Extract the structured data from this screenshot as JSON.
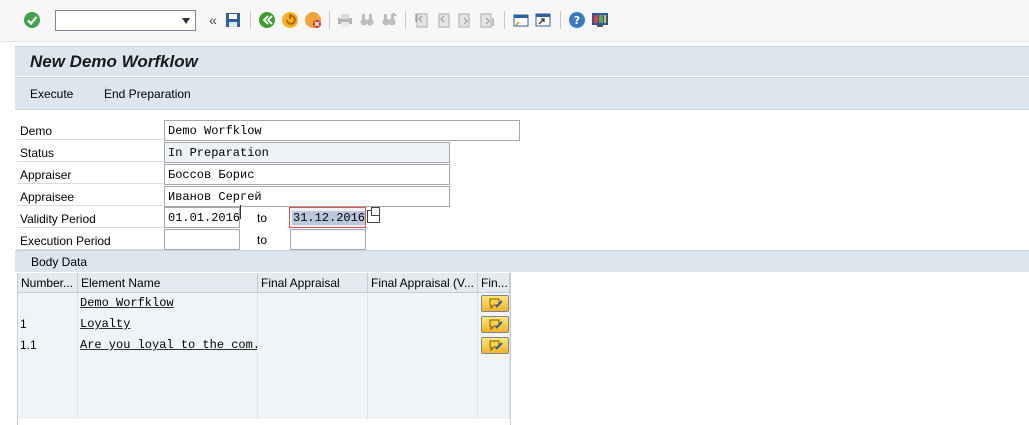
{
  "toolbar": {
    "command_field_value": "",
    "icons": [
      "enter-icon",
      "back-double-icon",
      "save-icon",
      "back-icon",
      "exit-icon",
      "cancel-icon",
      "print-icon",
      "find-icon",
      "find-next-icon",
      "first-page-icon",
      "previous-page-icon",
      "next-page-icon",
      "last-page-icon",
      "create-session-icon",
      "shortcut-icon",
      "help-icon",
      "customize-layout-icon"
    ]
  },
  "title": "New Demo Worfklow",
  "app_toolbar": {
    "execute": "Execute",
    "end_preparation": "End Preparation"
  },
  "form": {
    "demo_label": "Demo",
    "demo_value": "Demo Worfklow",
    "status_label": "Status",
    "status_value": "In Preparation",
    "appraiser_label": "Appraiser",
    "appraiser_value": "Боссов Борис",
    "appraisee_label": "Appraisee",
    "appraisee_value": "Иванов Сергей",
    "validity_label": "Validity Period",
    "validity_from": "01.01.2016",
    "validity_to_label": "to",
    "validity_to": "31.12.2016",
    "execution_label": "Execution Period",
    "execution_from": "",
    "execution_to_label": "to",
    "execution_to": ""
  },
  "body_data": {
    "tab_title": "Body Data",
    "columns": [
      "Number...",
      "Element Name",
      "Final Appraisal",
      "Final Appraisal (V...",
      "Fin..."
    ],
    "rows": [
      {
        "number": "",
        "element": "Demo Worfklow",
        "final": "",
        "final_v": ""
      },
      {
        "number": "1",
        "element": "Loyalty",
        "final": "",
        "final_v": ""
      },
      {
        "number": "1.1",
        "element": "Are you loyal to the com...",
        "final": "",
        "final_v": ""
      }
    ]
  },
  "colors": {
    "title_bg": "#dde6ef",
    "highlight_selection": "#b8c9dc",
    "required_border": "#d9534f"
  }
}
